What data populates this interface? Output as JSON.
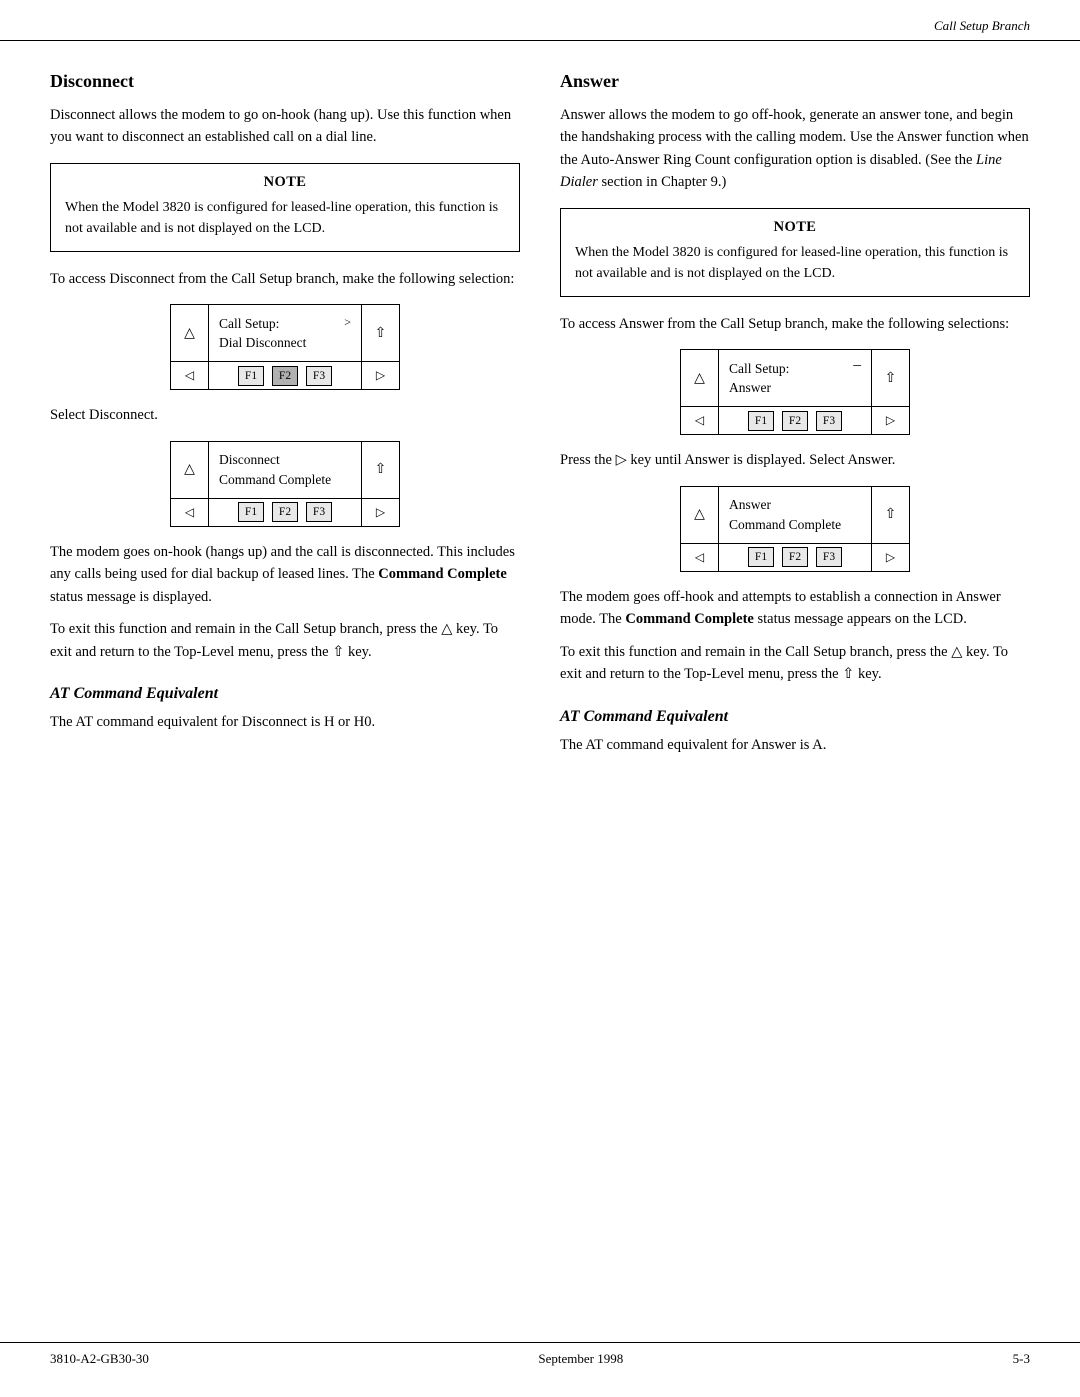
{
  "header": {
    "right_text": "Call Setup Branch"
  },
  "footer": {
    "left": "3810-A2-GB30-30",
    "center": "September 1998",
    "right": "5-3"
  },
  "left_column": {
    "title": "Disconnect",
    "intro": "Disconnect allows the modem to go on-hook (hang up). Use this function when you want to disconnect an established call on a dial line.",
    "note": {
      "title": "NOTE",
      "text": "When the Model 3820 is configured for leased-line operation, this function is not available and is not displayed on the LCD."
    },
    "access_text": "To access Disconnect from the Call Setup branch, make the following selection:",
    "lcd1": {
      "line1": "Call Setup:",
      "line2": "Dial  Disconnect",
      "icon": ">",
      "f2_active": true
    },
    "select_text": "Select Disconnect.",
    "lcd2": {
      "line1": "Disconnect",
      "line2": "Command Complete"
    },
    "body1": "The modem goes on-hook (hangs up) and the call is disconnected. This includes any calls being used for dial backup of leased lines. The",
    "body1_bold": "Command Complete",
    "body1_cont": "status message is displayed.",
    "body2": "To exit this function and remain in the Call Setup branch, press the",
    "body2_up": "△",
    "body2_mid": "key. To exit and return to the Top-Level menu, press the",
    "body2_double": "⇧",
    "body2_end": "key.",
    "at_title": "AT Command Equivalent",
    "at_text": "The AT command equivalent for Disconnect is H or H0."
  },
  "right_column": {
    "title": "Answer",
    "intro": "Answer allows the modem to go off-hook, generate an answer tone, and begin the handshaking process with the calling modem. Use the Answer function when the Auto-Answer Ring Count configuration option is disabled. (See the",
    "intro_italic": "Line Dialer",
    "intro_cont": "section in Chapter 9.)",
    "note": {
      "title": "NOTE",
      "text": "When the Model 3820 is configured for leased-line operation, this function is not available and is not displayed on the LCD."
    },
    "access_text": "To access Answer from the Call Setup branch, make the following selections:",
    "lcd1": {
      "line1": "Call Setup:",
      "line2": "Answer",
      "icon": "="
    },
    "select_text": "Press the",
    "select_arrow": "▷",
    "select_cont": "key until Answer is displayed. Select Answer.",
    "lcd2": {
      "line1": "Answer",
      "line2": "Command Complete"
    },
    "body1": "The modem goes off-hook and attempts to establish a connection in Answer mode. The",
    "body1_bold": "Command Complete",
    "body1_cont": "status message appears on the LCD.",
    "body2": "To exit this function and remain in the Call Setup branch, press the",
    "body2_up": "△",
    "body2_mid": "key. To exit and return to the Top-Level menu, press the",
    "body2_double": "⇧",
    "body2_end": "key.",
    "at_title": "AT Command Equivalent",
    "at_text": "The AT command equivalent for Answer is A."
  },
  "labels": {
    "f1": "F1",
    "f2": "F2",
    "f3": "F3"
  }
}
